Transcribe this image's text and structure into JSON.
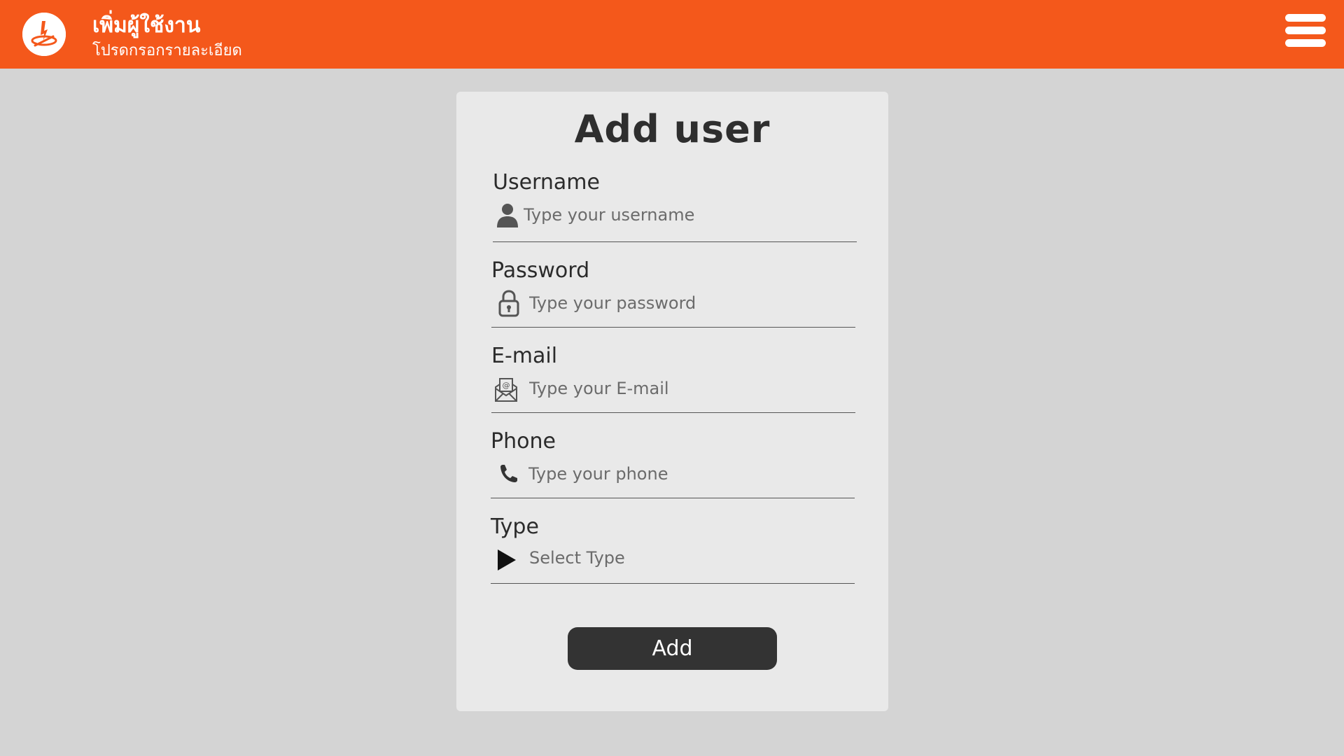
{
  "header": {
    "title": "เพิ่มผู้ใช้งาน",
    "subtitle": "โปรดกรอกรายละเอียด",
    "logo_icon": "torch-logo-icon",
    "menu_icon": "hamburger-menu-icon",
    "background_color": "#f4581b"
  },
  "form": {
    "title": "Add user",
    "fields": {
      "username": {
        "label": "Username",
        "placeholder": "Type your username",
        "icon": "user-icon",
        "value": ""
      },
      "password": {
        "label": "Password",
        "placeholder": "Type your password",
        "icon": "lock-icon",
        "value": ""
      },
      "email": {
        "label": "E-mail",
        "placeholder": "Type your E-mail",
        "icon": "envelope-icon",
        "value": ""
      },
      "phone": {
        "label": "Phone",
        "placeholder": "Type your phone",
        "icon": "phone-icon",
        "value": ""
      },
      "type": {
        "label": "Type",
        "selected": "Select Type",
        "icon": "play-arrow-icon"
      }
    },
    "submit_label": "Add",
    "button_color": "#333333"
  }
}
